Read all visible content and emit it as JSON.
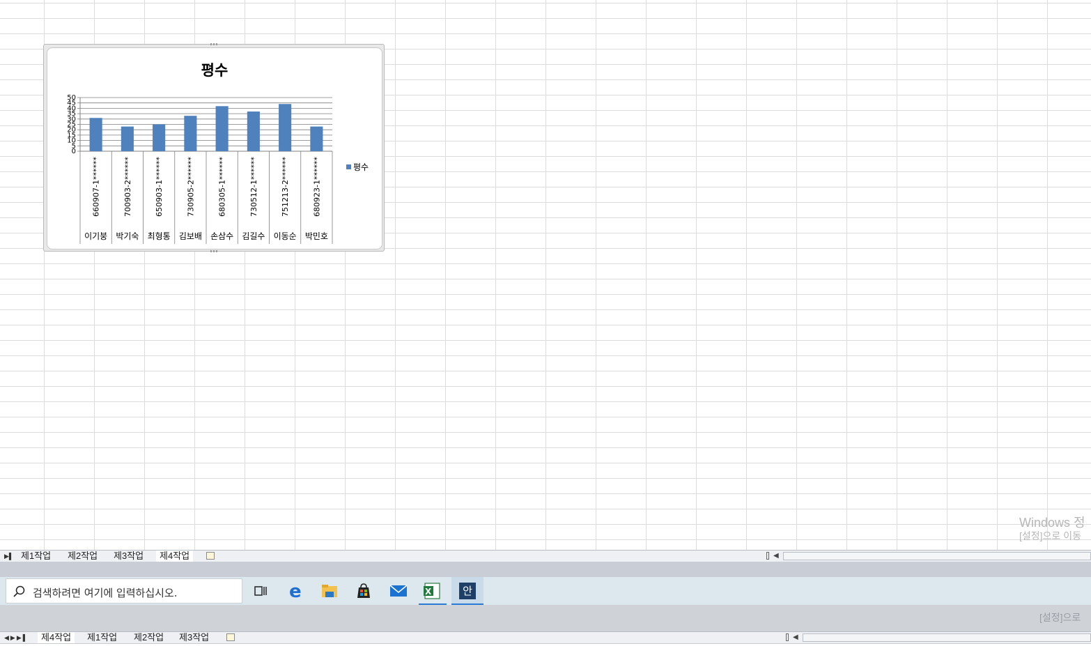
{
  "sheet_tabs_top": [
    "제1작업",
    "제2작업",
    "제3작업",
    "제4작업"
  ],
  "sheet_tabs_top_active": "제4작업",
  "sheet_tabs_bottom": [
    "제4작업",
    "제1작업",
    "제2작업",
    "제3작업"
  ],
  "sheet_tabs_bottom_active": "제4작업",
  "watermark": {
    "line1": "Windows 정",
    "line2": "[설정]으로 이동",
    "line2_lower": "[설정]으로"
  },
  "taskbar": {
    "search_placeholder": "검색하려면 여기에 입력하십시오.",
    "apps": [
      "task-view",
      "edge",
      "file-explorer",
      "store",
      "mail",
      "excel",
      "hangul"
    ],
    "hangul_label": "안"
  },
  "chart_data": {
    "type": "bar",
    "title": "평수",
    "categories": [
      {
        "top": "660907-1******",
        "bottom": "이기붕"
      },
      {
        "top": "700903-2******",
        "bottom": "박기숙"
      },
      {
        "top": "650903-1******",
        "bottom": "최형통"
      },
      {
        "top": "730905-2******",
        "bottom": "김보배"
      },
      {
        "top": "680305-1******",
        "bottom": "손삼수"
      },
      {
        "top": "730512-1******",
        "bottom": "김길수"
      },
      {
        "top": "751213-2******",
        "bottom": "이동순"
      },
      {
        "top": "680923-1******",
        "bottom": "박민호"
      }
    ],
    "series": [
      {
        "name": "평수",
        "values": [
          31,
          23,
          25,
          33,
          42,
          37,
          44,
          23
        ],
        "color": "#4f81bd"
      }
    ],
    "ylim": [
      0,
      50
    ],
    "yticks": [
      "0",
      "5",
      "10",
      "15",
      "20",
      "25",
      "30",
      "35",
      "40",
      "45",
      "50"
    ],
    "grid": true,
    "legend": "right"
  }
}
